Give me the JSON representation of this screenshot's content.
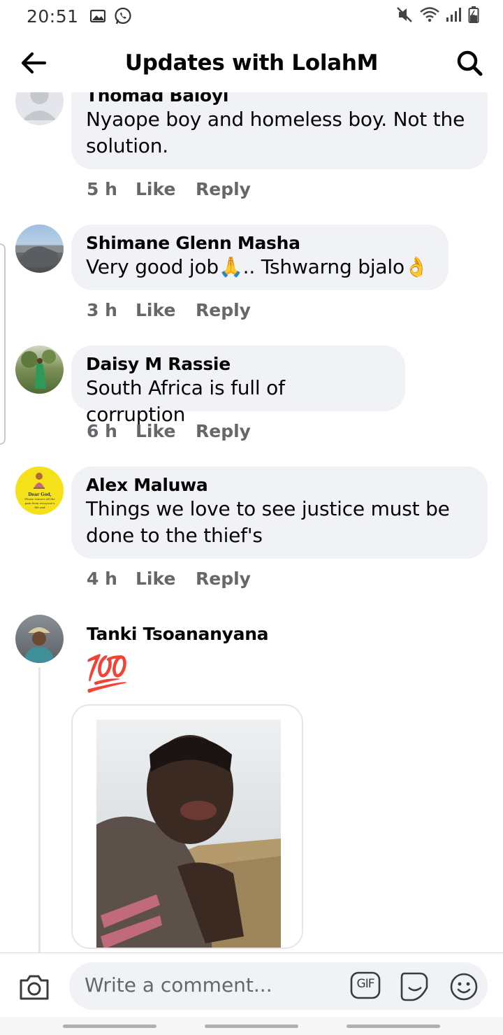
{
  "status_bar": {
    "time": "20:51"
  },
  "header": {
    "title": "Updates with LolahM"
  },
  "comments": [
    {
      "name": "Thomad Baloyi",
      "text": "Nyaope boy and homeless boy. Not the solution.",
      "time": "5 h",
      "like": "Like",
      "reply": "Reply"
    },
    {
      "name": "Shimane Glenn Masha",
      "text": "Very good job🙏.. Tshwarng bjalo👌",
      "time": "3 h",
      "like": "Like",
      "reply": "Reply"
    },
    {
      "name": "Daisy M Rassie",
      "text": "South Africa is full of corruption",
      "time": "6 h",
      "like": "Like",
      "reply": "Reply"
    },
    {
      "name": "Alex Maluwa",
      "text": "Things we love to see justice must be done to the thief's",
      "time": "4 h",
      "like": "Like",
      "reply": "Reply"
    },
    {
      "name": "Tanki Tsoananyana",
      "text": "💯"
    }
  ],
  "avatar_badge": {
    "line1": "Dear God,",
    "line2": "Please remove all the pain from everyone's life and"
  },
  "composer": {
    "placeholder": "Write a comment...",
    "gif_label": "GIF"
  },
  "colors": {
    "bubble": "#f0f2f5",
    "meta_text": "#65676b",
    "hundred_emoji": "#d0212b"
  }
}
